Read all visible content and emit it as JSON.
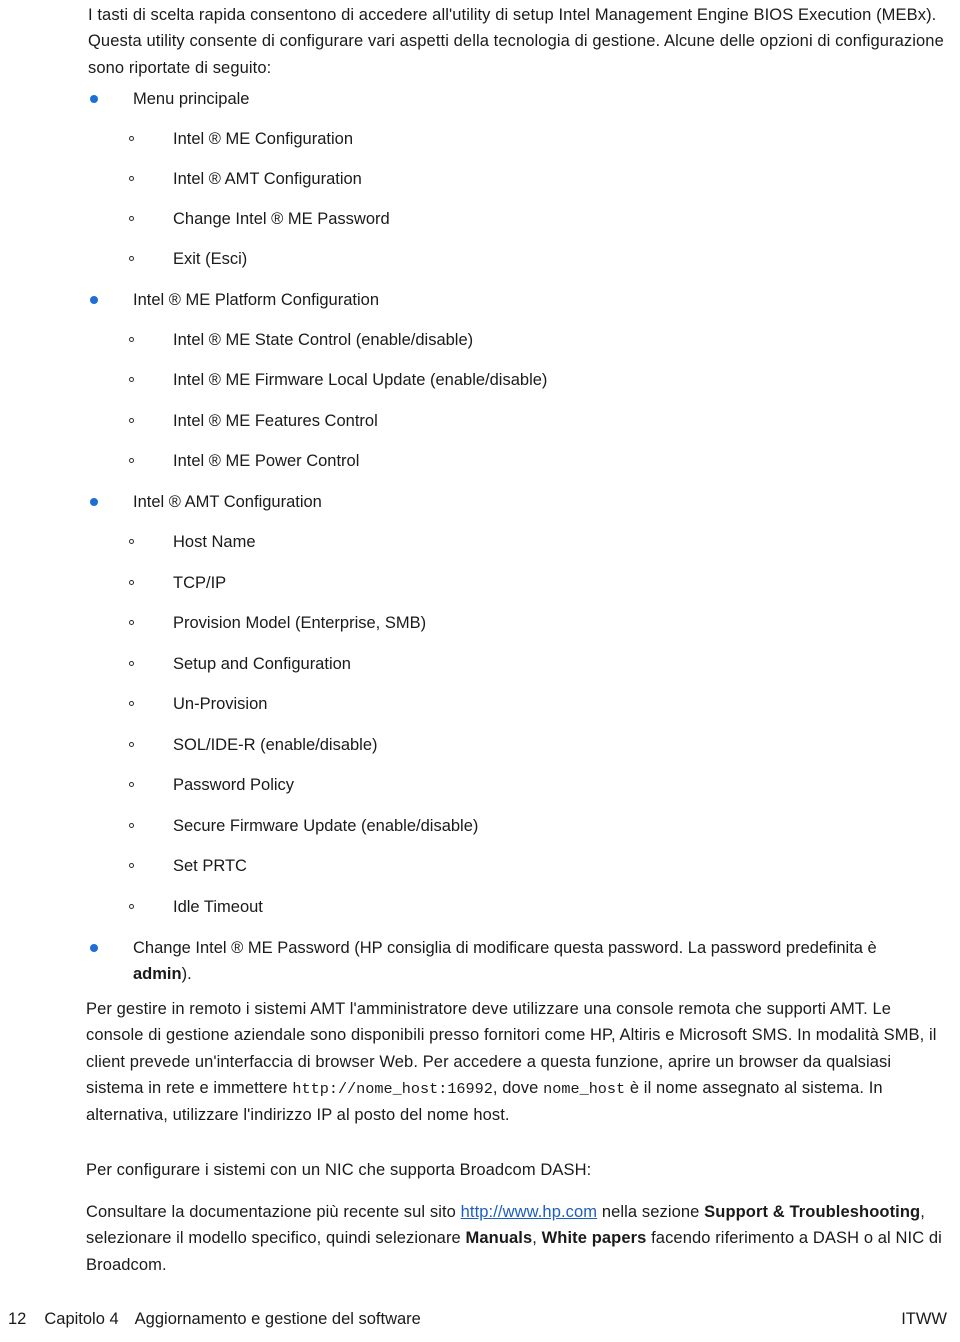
{
  "document": {
    "language": "it",
    "intro_paragraph": "I tasti di scelta rapida consentono di accedere all'utility di setup Intel Management Engine BIOS Execution (MEBx). Questa utility consente di configurare vari aspetti della tecnologia di gestione. Alcune delle opzioni di configurazione sono riportate di seguito:",
    "bullets": {
      "menu_principale": {
        "label": "Menu principale",
        "children": [
          "Intel ® ME Configuration",
          "Intel ® AMT Configuration",
          "Change Intel ® ME Password",
          "Exit (Esci)"
        ]
      },
      "me_platform_configuration": {
        "label": "Intel ® ME Platform Configuration",
        "children": [
          "Intel ® ME State Control (enable/disable)",
          "Intel ® ME Firmware Local Update (enable/disable)",
          "Intel ® ME Features Control",
          "Intel ® ME Power Control"
        ]
      },
      "amt_configuration": {
        "label": "Intel ® AMT Configuration",
        "children": [
          "Host Name",
          "TCP/IP",
          "Provision Model (Enterprise, SMB)",
          "Setup and Configuration",
          "Un-Provision",
          "SOL/IDE-R (enable/disable)",
          "Password Policy",
          "Secure Firmware Update (enable/disable)",
          "Set PRTC",
          "Idle Timeout"
        ]
      },
      "change_me_password": {
        "text_before_bold": "Change Intel ® ME Password (HP consiglia di modificare questa password. La password predefinita è ",
        "bold_word": "admin",
        "text_after_bold": ")."
      }
    },
    "paragraph_remote": {
      "part1": "Per gestire in remoto i sistemi AMT l'amministratore deve utilizzare una console remota che supporti AMT. Le console di gestione aziendale sono disponibili presso fornitori come HP, Altiris e Microsoft SMS. In modalità SMB, il client prevede un'interfaccia di browser Web. Per accedere a questa funzione, aprire un browser da qualsiasi sistema in rete e immettere ",
      "mono1": "http://nome_host:16992",
      "part2": ", dove ",
      "mono2": "nome_host",
      "part3": " è il nome assegnato al sistema. In alternativa, utilizzare l'indirizzo IP al posto del nome host."
    },
    "paragraph_broadcom": "Per configurare i sistemi con un NIC che supporta Broadcom DASH:",
    "paragraph_docs": {
      "part1": "Consultare la documentazione più recente sul sito ",
      "link_text": "http://www.hp.com",
      "part2": " nella sezione ",
      "bold1": "Support & Troubleshooting",
      "part3": ", selezionare il modello specifico, quindi selezionare ",
      "bold2": "Manuals",
      "part4": ", ",
      "bold3": "White papers",
      "part5": " facendo riferimento a DASH o al NIC di Broadcom."
    }
  },
  "footer": {
    "page_number": "12",
    "chapter": "Capitolo 4",
    "chapter_title": "Aggiornamento e gestione del software",
    "right_label": "ITWW"
  },
  "colors": {
    "bullet_level1": "#1c6fd4",
    "link": "#1c5fbe",
    "text": "#1a1a1a"
  }
}
